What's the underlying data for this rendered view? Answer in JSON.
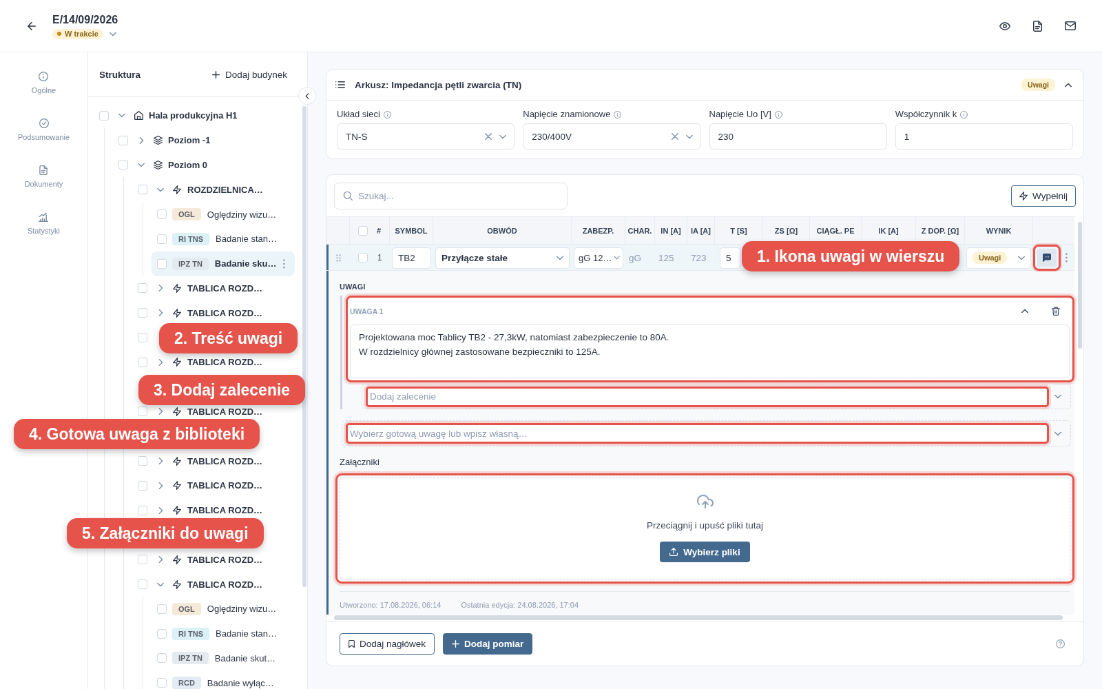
{
  "header": {
    "title": "E/14/09/2026",
    "status": "W trakcie"
  },
  "nav": [
    {
      "label": "Ogólne",
      "selected": false
    },
    {
      "label": "Podsumowanie",
      "selected": false
    },
    {
      "label": "Dokumenty",
      "selected": false
    },
    {
      "label": "Statystyki",
      "selected": false
    }
  ],
  "structure": {
    "title": "Struktura",
    "add_button": "Dodaj budynek",
    "tree": [
      {
        "kind": "building",
        "label": "Hala produkcyjna H1",
        "checked": false,
        "selected": false,
        "expanded": true,
        "children": [
          {
            "kind": "level",
            "label": "Poziom -1",
            "checked": false,
            "selected": false,
            "expanded": false
          },
          {
            "kind": "level",
            "label": "Poziom 0",
            "checked": false,
            "selected": false,
            "expanded": true,
            "children": [
              {
                "kind": "board",
                "label": "ROZDZIELNICA…",
                "checked": false,
                "selected": false,
                "expanded": true,
                "children": [
                  {
                    "kind": "test",
                    "tag": "OGL",
                    "color": "#f5ead9",
                    "label": "Oględziny wizu…",
                    "checked": false,
                    "selected": false
                  },
                  {
                    "kind": "test",
                    "tag": "RI TNS",
                    "color": "#dcf0f7",
                    "label": "Badanie stan…",
                    "checked": false,
                    "selected": false
                  },
                  {
                    "kind": "test",
                    "tag": "IPZ TN",
                    "color": "#e5eaf0",
                    "label": "Badanie sku…",
                    "checked": false,
                    "selected": true
                  }
                ]
              },
              {
                "kind": "board",
                "label": "TABLICA ROZD…",
                "checked": false,
                "selected": false,
                "expanded": false
              },
              {
                "kind": "board",
                "label": "TABLICA ROZD…",
                "checked": false,
                "selected": false,
                "expanded": false
              },
              {
                "kind": "covered",
                "checked": false
              },
              {
                "kind": "board",
                "label": "TABLICA ROZD…",
                "checked": false,
                "selected": false,
                "expanded": false
              },
              {
                "kind": "covered"
              },
              {
                "kind": "board",
                "label": "TABLICA ROZD…",
                "checked": false,
                "selected": false,
                "expanded": false
              },
              {
                "kind": "covered"
              },
              {
                "kind": "board",
                "label": "TABLICA ROZD…",
                "checked": false,
                "selected": false,
                "expanded": false
              },
              {
                "kind": "board",
                "label": "TABLICA ROZD…",
                "checked": false,
                "selected": false,
                "expanded": false
              },
              {
                "kind": "board",
                "label": "TABLICA ROZD…",
                "checked": false,
                "selected": false,
                "expanded": false
              },
              {
                "kind": "covered"
              },
              {
                "kind": "board",
                "label": "TABLICA ROZD…",
                "checked": false,
                "selected": false,
                "expanded": false
              },
              {
                "kind": "board",
                "label": "TABLICA ROZD…",
                "checked": false,
                "selected": false,
                "expanded": true,
                "children": [
                  {
                    "kind": "test",
                    "tag": "OGL",
                    "color": "#f5ead9",
                    "label": "Oględziny wizu…",
                    "checked": false,
                    "selected": false
                  },
                  {
                    "kind": "test",
                    "tag": "RI TNS",
                    "color": "#dcf0f7",
                    "label": "Badanie stan…",
                    "checked": false,
                    "selected": false
                  },
                  {
                    "kind": "test",
                    "tag": "IPZ TN",
                    "color": "#e5eaf0",
                    "label": "Badanie skut…",
                    "checked": false,
                    "selected": false
                  },
                  {
                    "kind": "test",
                    "tag": "RCD",
                    "color": "#e3ecf5",
                    "label": "Badanie wyłąc…",
                    "checked": false,
                    "selected": false
                  }
                ]
              }
            ]
          }
        ]
      }
    ]
  },
  "sheet": {
    "title": "Arkusz: Impedancja pętli zwarcia (TN)",
    "badge": "Uwagi",
    "expanded": true,
    "fields": [
      {
        "kind": "select",
        "label": "Układ sieci",
        "value": "TN-S"
      },
      {
        "kind": "select",
        "label": "Napięcie znamionowe",
        "value": "230/400V"
      },
      {
        "kind": "input",
        "label": "Napięcie Uo [V]",
        "value": "230"
      },
      {
        "kind": "input",
        "label": "Współczynnik k",
        "value": "1"
      }
    ]
  },
  "measurements": {
    "search": {
      "placeholder": "Szukaj..."
    },
    "fill_button": "Wypełnij",
    "all_checked": false,
    "columns": [
      "#",
      "SYMBOL",
      "OBWÓD",
      "ZABEZP.",
      "CHAR.",
      "IN [A]",
      "IA [A]",
      "T [S]",
      "ZS [Ω]",
      "CIĄGŁ. PE",
      "IK [A]",
      "Z DOP. [Ω]",
      "WYNIK"
    ],
    "rows": [
      {
        "checked": false,
        "number": "1",
        "symbol": "TB2",
        "circuit": "Przyłącze stałe",
        "protection": "gG 12…",
        "characteristic": "gG",
        "in": "125",
        "ia": "723",
        "t": "5",
        "result": "Uwagi",
        "note_button": {
          "highlighted": true
        },
        "expanded": true,
        "notes": {
          "heading": "UWAGI",
          "items": [
            {
              "title": "UWAGA 1",
              "expanded": true,
              "text": "Projektowana moc Tablicy TB2 - 27,3kW, natomiast zabezpieczenie to 80A.\nW rozdzielnicy głównej zastosowane bezpieczniki to 125A.",
              "highlighted": true,
              "recommendation": {
                "placeholder": "Dodaj zalecenie",
                "highlighted": true
              }
            }
          ],
          "library": {
            "placeholder": "Wybierz gotową uwagę lub wpisz własną…",
            "highlighted": true
          },
          "attachments": {
            "label": "Załączniki",
            "hint": "Przeciągnij i upuść pliki tutaj",
            "button": "Wybierz pliki",
            "highlighted": true
          },
          "created": "Utworzono: 17.08.2026, 06:14",
          "edited": "Ostatnia edycja: 24.08.2026, 17:04"
        }
      }
    ],
    "footer_buttons": [
      {
        "kind": "secondary",
        "label": "Dodaj nagłówek"
      },
      {
        "kind": "primary",
        "label": "Dodaj pomiar"
      }
    ]
  },
  "annotations": [
    "1. Ikona uwagi w wierszu",
    "2. Treść uwagi",
    "3. Dodaj zalecenie",
    "4. Gotowa uwaga z biblioteki",
    "5. Załączniki do uwagi"
  ]
}
